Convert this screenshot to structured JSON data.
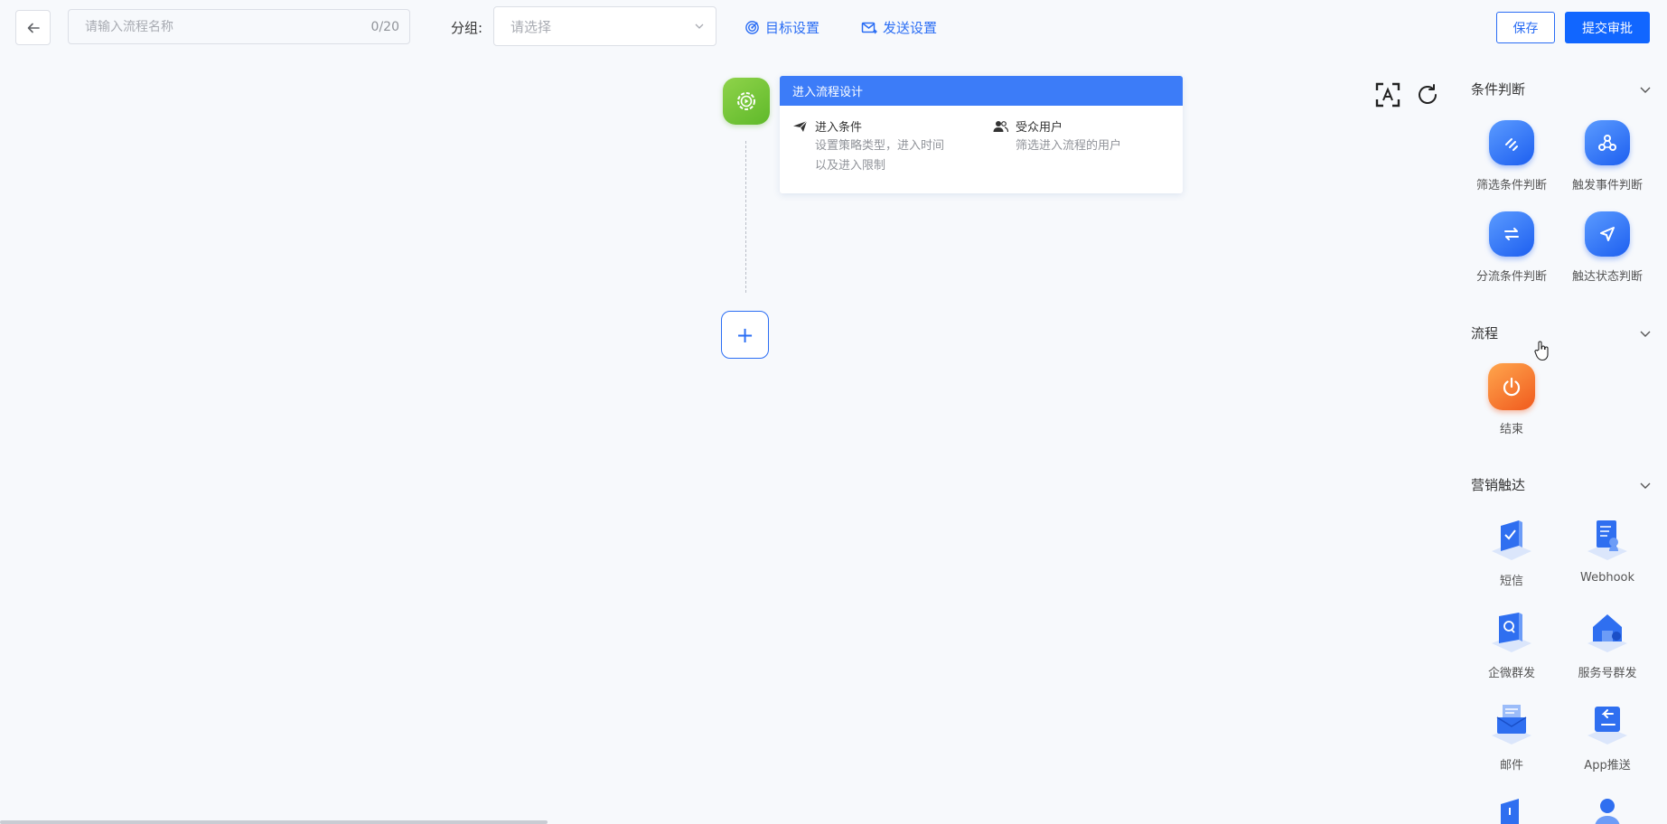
{
  "header": {
    "name_placeholder": "请输入流程名称",
    "name_value": "",
    "name_count": "0/20",
    "group_label": "分组:",
    "group_placeholder": "请选择",
    "target_settings": "目标设置",
    "send_settings": "发送设置",
    "save": "保存",
    "submit": "提交审批"
  },
  "canvas": {
    "entry_card": {
      "title": "进入流程设计",
      "enter_condition": {
        "title": "进入条件",
        "desc_line1": "设置策略类型，进入时间",
        "desc_line2": "以及进入限制"
      },
      "audience": {
        "title": "受众用户",
        "desc": "筛选进入流程的用户"
      }
    },
    "add_symbol": "+"
  },
  "panel": {
    "sections": [
      {
        "title": "条件判断",
        "items": [
          {
            "label": "筛选条件判断",
            "icon": "filter-icon"
          },
          {
            "label": "触发事件判断",
            "icon": "event-icon"
          },
          {
            "label": "分流条件判断",
            "icon": "split-icon"
          },
          {
            "label": "触达状态判断",
            "icon": "send-status-icon"
          }
        ]
      },
      {
        "title": "流程",
        "items": [
          {
            "label": "结束",
            "icon": "power-icon"
          }
        ]
      },
      {
        "title": "营销触达",
        "items": [
          {
            "label": "短信",
            "icon": "sms-icon"
          },
          {
            "label": "Webhook",
            "icon": "webhook-icon"
          },
          {
            "label": "企微群发",
            "icon": "wecom-icon"
          },
          {
            "label": "服务号群发",
            "icon": "service-account-icon"
          },
          {
            "label": "邮件",
            "icon": "email-icon"
          },
          {
            "label": "App推送",
            "icon": "app-push-icon"
          }
        ]
      }
    ]
  },
  "colors": {
    "primary": "#1166ff",
    "accent": "#2a6df4",
    "start_node": "#6cc435",
    "end_node": "#f56a2a",
    "background": "#f7f9fc"
  }
}
